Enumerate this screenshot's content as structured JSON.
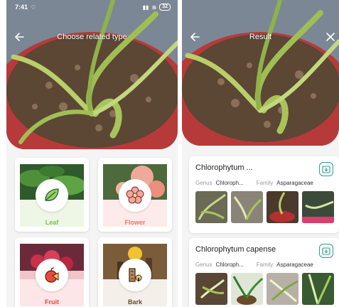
{
  "status": {
    "time": "7:41",
    "battery": "32"
  },
  "left_screen": {
    "title": "Choose related type",
    "categories": [
      {
        "label": "Leaf",
        "icon": "leaf-icon",
        "color": "#7bc14f"
      },
      {
        "label": "Flower",
        "icon": "flower-icon",
        "color": "#e67a6a"
      },
      {
        "label": "Fruit",
        "icon": "fruit-icon",
        "color": "#e54b3c"
      },
      {
        "label": "Bark",
        "icon": "bark-icon",
        "color": "#6b4a2a"
      }
    ]
  },
  "right_screen": {
    "title": "Result",
    "results": [
      {
        "name": "Chlorophytum ...",
        "genus_label": "Genus",
        "genus": "Chloroph...",
        "family_label": "Family",
        "family": "Asparagaceae"
      },
      {
        "name": "Chlorophytum capense",
        "genus_label": "Genus",
        "genus": "Chloroph...",
        "family_label": "Family",
        "family": "Asparagaceae"
      }
    ]
  },
  "colors": {
    "accent": "#2a9d8f",
    "leaf_bg": "#eef7e6",
    "flower_bg": "#fcebea",
    "fruit_bg": "#fde6e7",
    "bark_bg": "#f4efe9"
  }
}
